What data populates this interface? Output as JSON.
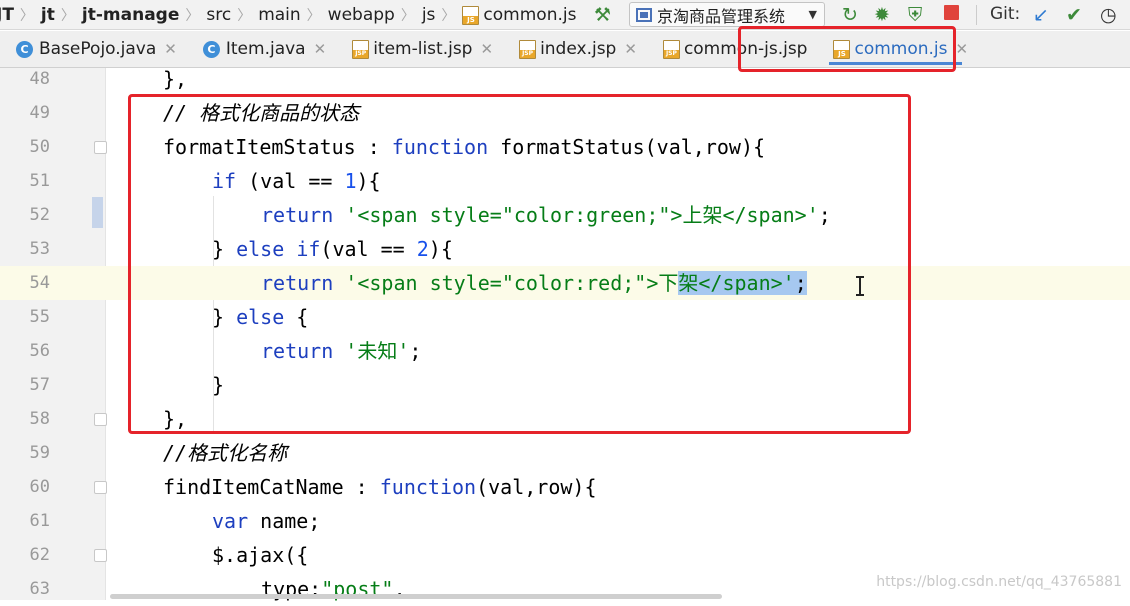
{
  "breadcrumb": [
    {
      "label": "JT",
      "bold": true
    },
    {
      "label": "jt",
      "bold": true
    },
    {
      "label": "jt-manage",
      "bold": true
    },
    {
      "label": "src",
      "bold": false
    },
    {
      "label": "main",
      "bold": false
    },
    {
      "label": "webapp",
      "bold": false
    },
    {
      "label": "js",
      "bold": false
    },
    {
      "label": "common.js",
      "bold": false
    }
  ],
  "toolbar": {
    "run_config": "京淘商品管理系统",
    "git_label": "Git:",
    "colors": {
      "run": "#3d8a3a",
      "debug": "#3d8a3a",
      "stop": "#e0433c",
      "git_update": "#2e7ad1",
      "git_commit": "#3d8a3a"
    }
  },
  "tabs": [
    {
      "label": "BasePojo.java",
      "icon": "class-icon",
      "active": false
    },
    {
      "label": "Item.java",
      "icon": "class-icon",
      "active": false
    },
    {
      "label": "item-list.jsp",
      "icon": "jsp-file-icon",
      "active": false
    },
    {
      "label": "index.jsp",
      "icon": "jsp-file-icon",
      "active": false
    },
    {
      "label": "common-js.jsp",
      "icon": "jsp-file-icon",
      "active": false
    },
    {
      "label": "common.js",
      "icon": "js-file-icon",
      "active": true
    }
  ],
  "editor": {
    "line_numbers": [
      "48",
      "49",
      "50",
      "51",
      "52",
      "53",
      "54",
      "55",
      "56",
      "57",
      "58",
      "59",
      "60",
      "61",
      "62",
      "63"
    ],
    "current_line": "54",
    "code": {
      "l48": "},",
      "l49_comment": "// 格式化商品的状态",
      "l50_prop": "formatItemStatus",
      "l50_colon": " : ",
      "l50_kw": "function",
      "l50_rest": " formatStatus(val,row){",
      "l51_kw": "if",
      "l51_a": " (val == ",
      "l51_num": "1",
      "l51_b": "){",
      "l52_kw": "return",
      "l52_str": " '<span style=\"color:green;\">上架</span>'",
      "l52_end": ";",
      "l53_a": "} ",
      "l53_kw1": "else",
      "l53_sp": " ",
      "l53_kw2": "if",
      "l53_b": "(val == ",
      "l53_num": "2",
      "l53_c": "){",
      "l54_kw": "return",
      "l54_str_a": " '<span style=\"color:red;\">下",
      "l54_str_sel": "架</span>'",
      "l54_end": ";",
      "l55_a": "} ",
      "l55_kw": "else",
      "l55_b": " {",
      "l56_kw": "return",
      "l56_str": " '未知'",
      "l56_end": ";",
      "l57": "}",
      "l58": "},",
      "l59_comment": "//格式化名称",
      "l60_prop": "findItemCatName",
      "l60_colon": " : ",
      "l60_kw": "function",
      "l60_rest": "(val,row){",
      "l61_kw": "var",
      "l61_rest": " name;",
      "l62": "$.ajax({",
      "l63_a": "type:",
      "l63_str": "\"post\"",
      "l63_b": ","
    }
  },
  "watermark": "https://blog.csdn.net/qq_43765881"
}
